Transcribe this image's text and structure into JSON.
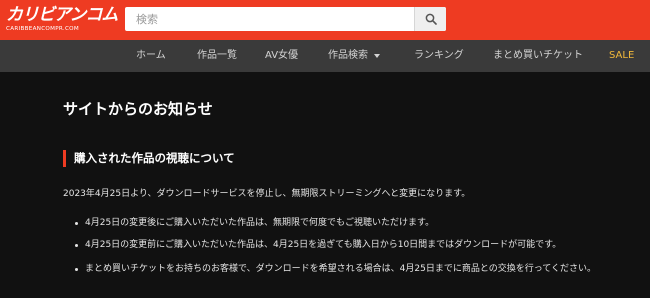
{
  "header": {
    "logo_main": "カリビアンコム",
    "logo_sub": "CARIBBEANCOMPR.COM",
    "search": {
      "placeholder": "検索",
      "button_icon": "search-icon"
    },
    "colors": {
      "brand": "#ee3b22"
    }
  },
  "nav": {
    "items": [
      {
        "label": "ホーム"
      },
      {
        "label": "作品一覧"
      },
      {
        "label": "AV女優"
      },
      {
        "label": "作品検索",
        "icon": "caret-down-icon"
      },
      {
        "label": "ランキング"
      },
      {
        "label": "まとめ買いチケット"
      },
      {
        "label": "SALE",
        "color": "#f0b83a"
      }
    ]
  },
  "main": {
    "title": "サイトからのお知らせ",
    "section_title": "購入された作品の視聴について",
    "intro": "2023年4月25日より、ダウンロードサービスを停止し、無期限ストリーミングへと変更になります。",
    "bullets": [
      "4月25日の変更後にご購入いただいた作品は、無期限で何度でもご視聴いただけます。",
      "4月25日の変更前にご購入いただいた作品は、4月25日を過ぎても購入日から10日間まではダウンロードが可能です。",
      "まとめ買いチケットをお持ちのお客様で、ダウンロードを希望される場合は、4月25日までに商品との交換を行ってください。"
    ]
  }
}
